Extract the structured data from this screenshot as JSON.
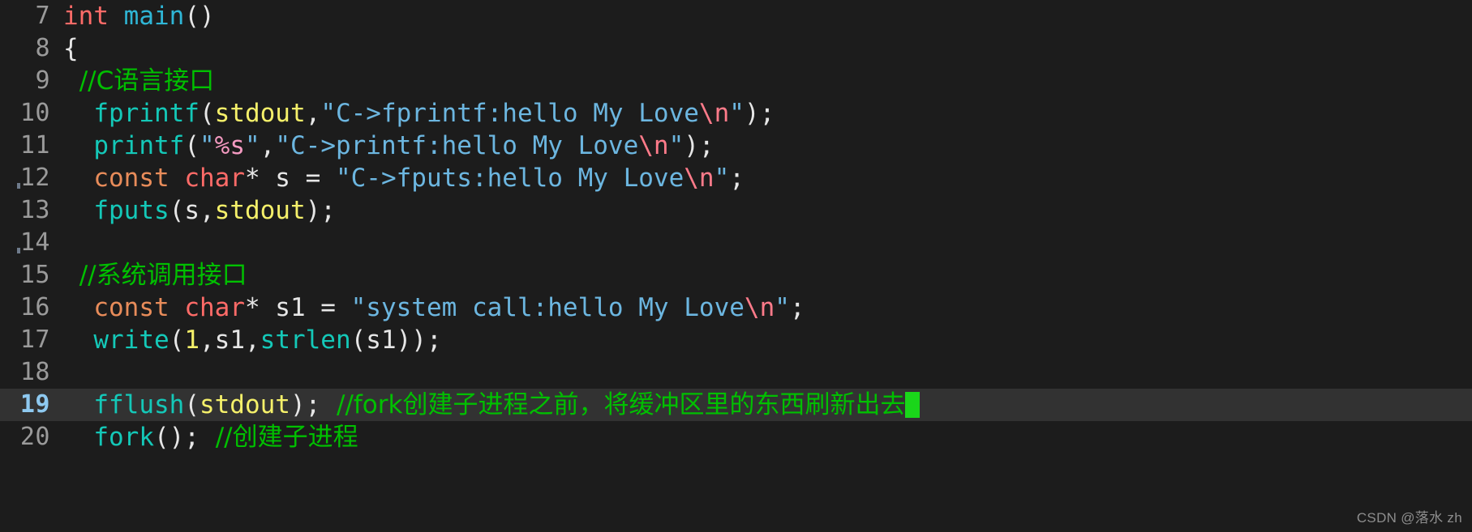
{
  "editor": {
    "background": "#1c1c1c",
    "active_line_background": "#323232",
    "active_line_number": "19",
    "cursor_color": "#1ad61a",
    "gutter_color": "#9a9a9a",
    "active_gutter_color": "#8ec9f0"
  },
  "watermark": {
    "text": "CSDN @落水 zh"
  },
  "lines": [
    {
      "number": "7",
      "active": false,
      "tokens": [
        {
          "cls": "t-type",
          "text": "int"
        },
        {
          "cls": "t-plain",
          "text": " "
        },
        {
          "cls": "t-entry",
          "text": "main"
        },
        {
          "cls": "t-punct",
          "text": "()"
        }
      ]
    },
    {
      "number": "8",
      "active": false,
      "tokens": [
        {
          "cls": "t-punct",
          "text": "{"
        }
      ]
    },
    {
      "number": "9",
      "active": false,
      "tokens": [
        {
          "cls": "t-cmt",
          "text": "  //C语言接口"
        }
      ]
    },
    {
      "number": "10",
      "active": false,
      "tokens": [
        {
          "cls": "t-plain",
          "text": "  "
        },
        {
          "cls": "t-fn",
          "text": "fprintf"
        },
        {
          "cls": "t-punct",
          "text": "("
        },
        {
          "cls": "t-macro",
          "text": "stdout"
        },
        {
          "cls": "t-punct",
          "text": ","
        },
        {
          "cls": "t-str",
          "text": "\"C->fprintf:hello My Love"
        },
        {
          "cls": "t-esc",
          "text": "\\n"
        },
        {
          "cls": "t-str",
          "text": "\""
        },
        {
          "cls": "t-punct",
          "text": ");"
        }
      ]
    },
    {
      "number": "11",
      "active": false,
      "tokens": [
        {
          "cls": "t-plain",
          "text": "  "
        },
        {
          "cls": "t-fn",
          "text": "printf"
        },
        {
          "cls": "t-punct",
          "text": "("
        },
        {
          "cls": "t-str",
          "text": "\""
        },
        {
          "cls": "t-fmt",
          "text": "%s"
        },
        {
          "cls": "t-str",
          "text": "\""
        },
        {
          "cls": "t-punct",
          "text": ","
        },
        {
          "cls": "t-str",
          "text": "\"C->printf:hello My Love"
        },
        {
          "cls": "t-esc",
          "text": "\\n"
        },
        {
          "cls": "t-str",
          "text": "\""
        },
        {
          "cls": "t-punct",
          "text": ");"
        }
      ]
    },
    {
      "number": "12",
      "active": false,
      "tokens": [
        {
          "cls": "t-plain",
          "text": "  "
        },
        {
          "cls": "t-kw",
          "text": "const"
        },
        {
          "cls": "t-plain",
          "text": " "
        },
        {
          "cls": "t-type",
          "text": "char"
        },
        {
          "cls": "t-punct",
          "text": "* s = "
        },
        {
          "cls": "t-str",
          "text": "\"C->fputs:hello My Love"
        },
        {
          "cls": "t-esc",
          "text": "\\n"
        },
        {
          "cls": "t-str",
          "text": "\""
        },
        {
          "cls": "t-punct",
          "text": ";"
        }
      ]
    },
    {
      "number": "13",
      "active": false,
      "tokens": [
        {
          "cls": "t-plain",
          "text": "  "
        },
        {
          "cls": "t-fn",
          "text": "fputs"
        },
        {
          "cls": "t-punct",
          "text": "(s,"
        },
        {
          "cls": "t-macro",
          "text": "stdout"
        },
        {
          "cls": "t-punct",
          "text": ");"
        }
      ]
    },
    {
      "number": "14",
      "active": false,
      "tokens": []
    },
    {
      "number": "15",
      "active": false,
      "tokens": [
        {
          "cls": "t-cmt",
          "text": "  //系统调用接口"
        }
      ]
    },
    {
      "number": "16",
      "active": false,
      "tokens": [
        {
          "cls": "t-plain",
          "text": "  "
        },
        {
          "cls": "t-kw",
          "text": "const"
        },
        {
          "cls": "t-plain",
          "text": " "
        },
        {
          "cls": "t-type",
          "text": "char"
        },
        {
          "cls": "t-punct",
          "text": "* s1 = "
        },
        {
          "cls": "t-str",
          "text": "\"system call:hello My Love"
        },
        {
          "cls": "t-esc",
          "text": "\\n"
        },
        {
          "cls": "t-str",
          "text": "\""
        },
        {
          "cls": "t-punct",
          "text": ";"
        }
      ]
    },
    {
      "number": "17",
      "active": false,
      "tokens": [
        {
          "cls": "t-plain",
          "text": "  "
        },
        {
          "cls": "t-fn",
          "text": "write"
        },
        {
          "cls": "t-punct",
          "text": "("
        },
        {
          "cls": "t-num",
          "text": "1"
        },
        {
          "cls": "t-punct",
          "text": ",s1,"
        },
        {
          "cls": "t-fn",
          "text": "strlen"
        },
        {
          "cls": "t-punct",
          "text": "(s1));"
        }
      ]
    },
    {
      "number": "18",
      "active": false,
      "tokens": []
    },
    {
      "number": "19",
      "active": true,
      "tokens": [
        {
          "cls": "t-plain",
          "text": "  "
        },
        {
          "cls": "t-fn",
          "text": "fflush"
        },
        {
          "cls": "t-punct",
          "text": "("
        },
        {
          "cls": "t-macro",
          "text": "stdout"
        },
        {
          "cls": "t-punct",
          "text": ");"
        },
        {
          "cls": "t-cmt",
          "text": "  //fork创建子进程之前，将缓冲区里的东西刷新出去"
        }
      ],
      "cursor": true
    },
    {
      "number": "20",
      "active": false,
      "tokens": [
        {
          "cls": "t-plain",
          "text": "  "
        },
        {
          "cls": "t-fn",
          "text": "fork"
        },
        {
          "cls": "t-punct",
          "text": "();"
        },
        {
          "cls": "t-cmt",
          "text": "  //创建子进程"
        }
      ]
    }
  ]
}
